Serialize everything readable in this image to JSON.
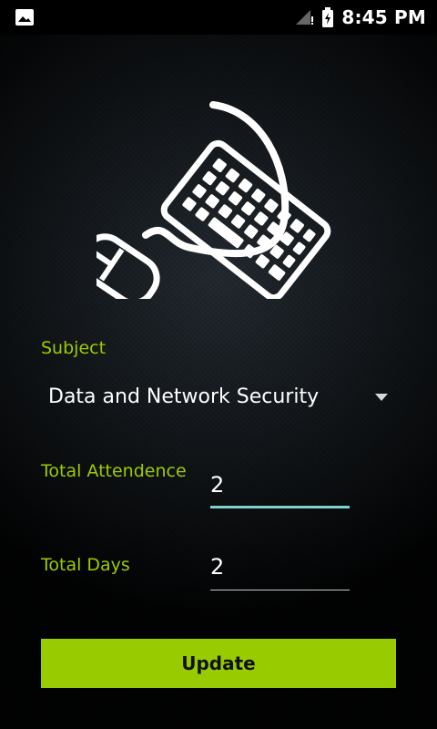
{
  "status_bar": {
    "time": "8:45 PM",
    "icons": [
      "image-icon",
      "signal-icon",
      "battery-icon"
    ]
  },
  "form": {
    "subject_label": "Subject",
    "subject_value": "Data and Network Security",
    "total_attendance_label": "Total Attendence",
    "total_attendance_value": "2",
    "total_days_label": "Total Days",
    "total_days_value": "2",
    "update_button": "Update"
  },
  "colors": {
    "accent": "#99cc00",
    "label": "#9dcb00",
    "focus_line": "#7fd1c9",
    "background": "#0b0f12"
  }
}
